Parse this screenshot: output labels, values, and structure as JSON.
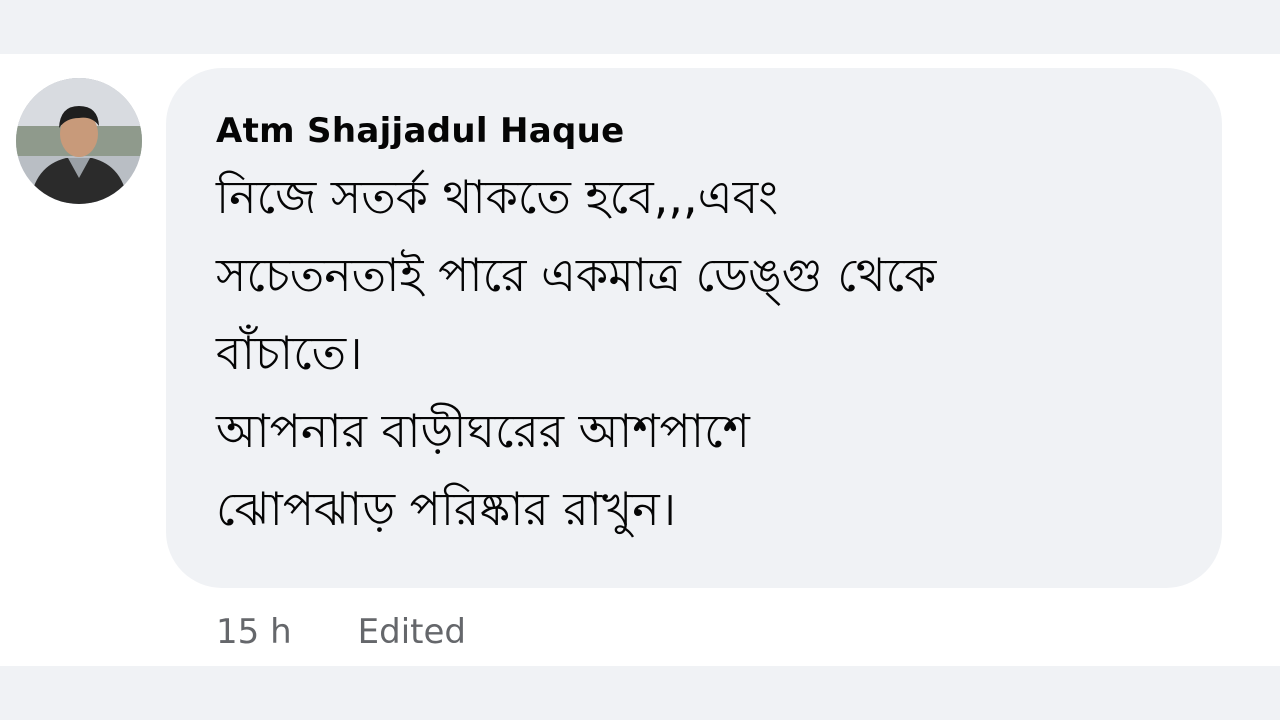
{
  "comment": {
    "author": "Atm Shajjadul Haque",
    "text": "নিজে সতর্ক থাকতে হবে,,,এবং\nসচেতনতাই পারে একমাত্র ডেঙ্গু থেকে\nবাঁচাতে।\nআপনার বাড়ীঘরের আশপাশে\nঝোপঝাড় পরিষ্কার রাখুন।",
    "timestamp": "15 h",
    "edited_label": "Edited"
  },
  "colors": {
    "bubble": "#f0f2f5",
    "text": "#050505",
    "meta": "#65676b"
  },
  "icons": {
    "avatar": "user-avatar"
  }
}
